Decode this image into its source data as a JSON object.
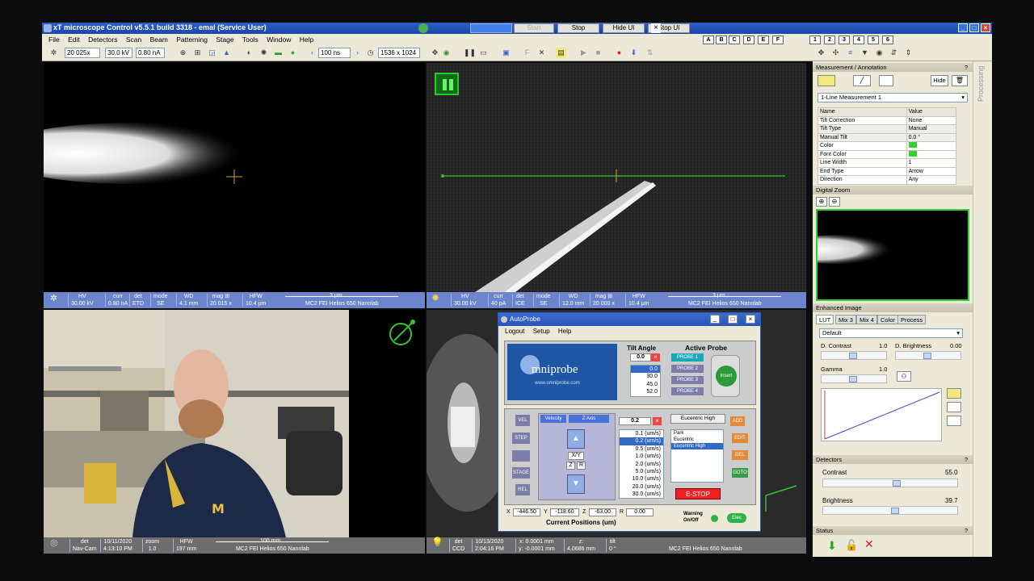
{
  "title_bar": {
    "title": "xT microscope Control v5.5.1 build 3318 - emal (Service User)",
    "start": "Start",
    "stop": "Stop",
    "hide_ui": "Hide UI",
    "stop_ui": "Stop UI"
  },
  "menu": [
    "File",
    "Edit",
    "Detectors",
    "Scan",
    "Beam",
    "Patterning",
    "Stage",
    "Tools",
    "Window",
    "Help"
  ],
  "toolbar": {
    "magnification": "20 025x",
    "hv": "30.0 kV",
    "current": "0.80 nA",
    "dwell": "100 ns",
    "resolution": "1536 x 1024"
  },
  "annotation_letters": [
    "A",
    "B",
    "C",
    "D",
    "E",
    "F"
  ],
  "annotation_numbers": [
    "1",
    "2",
    "3",
    "4",
    "5",
    "6"
  ],
  "quad1": {
    "scale": "3 μm",
    "instrument": "MC2 FEI Helios 650 Nanolab",
    "cols": [
      {
        "h": "HV",
        "v": "30.00 kV"
      },
      {
        "h": "curr",
        "v": "0.80 nA"
      },
      {
        "h": "det",
        "v": "ETD"
      },
      {
        "h": "mode",
        "v": "SE"
      },
      {
        "h": "WD",
        "v": "4.1 mm"
      },
      {
        "h": "mag ⊞",
        "v": "20 015 x"
      },
      {
        "h": "HFW",
        "v": "10.4 μm"
      }
    ]
  },
  "quad2": {
    "scale": "3 μm",
    "instrument": "MC2 FEI Helios 650 Nanolab",
    "cols": [
      {
        "h": "HV",
        "v": "30.00 kV"
      },
      {
        "h": "curr",
        "v": "40 pA"
      },
      {
        "h": "det",
        "v": "ICE"
      },
      {
        "h": "mode",
        "v": "SE"
      },
      {
        "h": "WD",
        "v": "12.0 mm"
      },
      {
        "h": "mag ⊞",
        "v": "20 000 x"
      },
      {
        "h": "HFW",
        "v": "10.4 μm"
      }
    ]
  },
  "quad3": {
    "scale": "100 mm",
    "instrument": "MC2 FEI Helios 650 Nanolab",
    "cols": [
      {
        "h": "det",
        "v": "Nav-Cam"
      },
      {
        "h": "10/11/2020",
        "v": "4:13:10 PM"
      },
      {
        "h": "zoom",
        "v": "1.0"
      },
      {
        "h": "HFW",
        "v": "197 mm"
      }
    ]
  },
  "quad4": {
    "instrument": "MC2 FEI Helios 650 Nanolab",
    "cols": [
      {
        "h": "det",
        "v": "CCD"
      },
      {
        "h": "10/13/2020",
        "v": "2:04:16 PM"
      },
      {
        "h": "x: 0.0001 mm",
        "v": "y: -0.0001 mm"
      },
      {
        "h": "z:",
        "v": "4.0686 mm"
      },
      {
        "h": "tilt",
        "v": "0 °"
      }
    ]
  },
  "right_panel": {
    "processing_tab": "Processing",
    "measurement_header": "Measurement / Annotation",
    "hide": "Hide",
    "measurement_select": "1-Line Measurement 1",
    "props_header": [
      "Name",
      "Value"
    ],
    "props": [
      [
        "Tilt Correction",
        "None"
      ],
      [
        "Tilt Type",
        "Manual"
      ],
      [
        "Manual Tilt",
        "0.0 °"
      ],
      [
        "Color",
        ""
      ],
      [
        "Font Color",
        ""
      ],
      [
        "Line Width",
        "1"
      ],
      [
        "End Type",
        "Arrow"
      ],
      [
        "Direction",
        "Any"
      ]
    ],
    "digital_zoom": "Digital Zoom",
    "enhanced_image": "Enhanced Image",
    "tabs": [
      "LUT",
      "Mix 3",
      "Mix 4",
      "Color",
      "Process"
    ],
    "lut_select": "Default",
    "d_contrast_label": "D. Contrast",
    "d_contrast": "1.0",
    "d_brightness_label": "D. Brightness",
    "d_brightness": "0.00",
    "gamma_label": "Gamma",
    "gamma": "1.0",
    "detectors": "Detectors",
    "contrast_label": "Contrast",
    "contrast": "55.0",
    "brightness_label": "Brightness",
    "brightness": "39.7",
    "status": "Status",
    "help": "?"
  },
  "autoprobe": {
    "title": "AutoProbe",
    "menu": [
      "Logout",
      "Setup",
      "Help"
    ],
    "logo": "mniprobe",
    "url": "www.omniprobe.com",
    "tilt_angle": "Tilt Angle",
    "tilt_value": "0.0",
    "tilt_options": [
      "0.0",
      "30.0",
      "45.0",
      "52.0"
    ],
    "active_probe": "Active Probe",
    "probes": [
      "PROBE 1",
      "PROBE 2",
      "PROBE 3",
      "PROBE 4"
    ],
    "insert": "Insert",
    "vel": "VEL",
    "step": "STEP",
    "stage": "STAGE",
    "rel": "REL",
    "velocity": "Velocity",
    "z_axis": "Z Axis",
    "xy": "X/Y",
    "z": "Z",
    "r": "R",
    "velocity_value": "0.2",
    "velocities": [
      "0.1 (um/s)",
      "0.2 (um/s)",
      "0.5 (um/s)",
      "1.0 (um/s)",
      "2.0 (um/s)",
      "5.0 (um/s)",
      "10.0 (um/s)",
      "20.0 (um/s)",
      "30.0 (um/s)"
    ],
    "eucentric_header": "Eucentric High",
    "positions_list": [
      "Park",
      "Eucentric",
      "Eucentric High"
    ],
    "add": "ADD",
    "edit": "EDIT",
    "del": "DEL",
    "goto": "GOTO",
    "estop": "E-STOP",
    "x_label": "X",
    "x": "-446.50",
    "y_label": "Y",
    "y": "-118.60",
    "z_label": "Z",
    "zv": "-63.00",
    "r_label": "R",
    "rv": "0.00",
    "current_positions": "Current Positions (um)",
    "warning": "Warning",
    "on_off": "On/Off",
    "elec": "Elec"
  }
}
